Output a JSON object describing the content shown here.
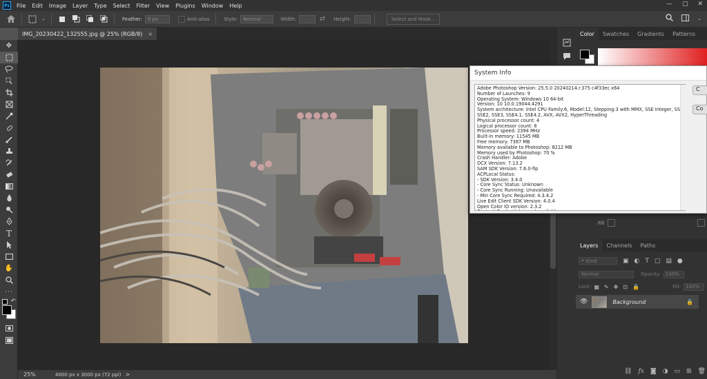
{
  "app": {
    "logo": "Ps"
  },
  "menu": [
    "File",
    "Edit",
    "Image",
    "Layer",
    "Type",
    "Select",
    "Filter",
    "View",
    "Plugins",
    "Window",
    "Help"
  ],
  "window_controls": {
    "minimize": "—",
    "maximize": "▢",
    "close": "✕"
  },
  "options_bar": {
    "feather_label": "Feather:",
    "feather_value": "0 px",
    "anti_alias": "Anti-alias",
    "style_label": "Style:",
    "style_value": "Normal",
    "width_label": "Width:",
    "height_label": "Height:",
    "select_mask": "Select and Mask..."
  },
  "document": {
    "tab_title": "IMG_20230422_132555.jpg @ 25% (RGB/8)",
    "close": "×"
  },
  "status": {
    "zoom": "25%",
    "info": "4000 px x 3000 px (72 ppi)",
    "arrow": ">"
  },
  "color_panel": {
    "tabs": [
      "Color",
      "Swatches",
      "Gradients",
      "Patterns"
    ]
  },
  "layers_panel": {
    "tabs": [
      "Layers",
      "Channels",
      "Paths"
    ],
    "kind": "Kind",
    "blend": "Normal",
    "opacity_label": "Opacity:",
    "opacity_value": "100%",
    "lock_label": "Lock:",
    "fill_label": "Fill:",
    "fill_value": "100%",
    "layer_name": "Background"
  },
  "properties_panel": {
    "fill_label": "Fill"
  },
  "system_info": {
    "title": "System Info",
    "lines": [
      "Adobe Photoshop Version: 25.5.0 20240214.r.375 c4f33ec  x64",
      "Number of Launches: 9",
      "Operating System: Windows 10 64-bit",
      "Version: 10 10.0.19044.4291",
      "System architecture: Intel CPU Family:6, Model:12, Stepping:3 with MMX, SSE Integer, SSE FP,",
      "SSE2, SSE3, SSE4.1, SSE4.2, AVX, AVX2, HyperThreading",
      "Physical processor count: 4",
      "Logical processor count: 8",
      "Processor speed: 2394 MHz",
      "Built-in memory: 11545 MB",
      "Free memory: 7387 MB",
      "Memory available to Photoshop: 8212 MB",
      "Memory used by Photoshop: 70 %",
      "Crash Handler: Adobe",
      "DCX Version: 7.13.2",
      "SAM SDK Version: 7.6.0-fip",
      "ACPLocal Status:",
      "  - SDK Version: 3.4.0",
      "  - Core Sync Status: Unknown",
      "  - Core Sync Running: Unavailable",
      "  - Min Core Sync Required: 4.3.4.2",
      "Live Edit Client SDK Version: 4.0.4",
      "Open Color IO version: 2.3.2",
      "Content Credentials is not available"
    ],
    "buttons": [
      "C",
      "Co"
    ]
  },
  "colors": {
    "accent": "#31a8ff",
    "foreground": "#000000",
    "background": "#ffffff",
    "hue_red": "#e02020"
  }
}
